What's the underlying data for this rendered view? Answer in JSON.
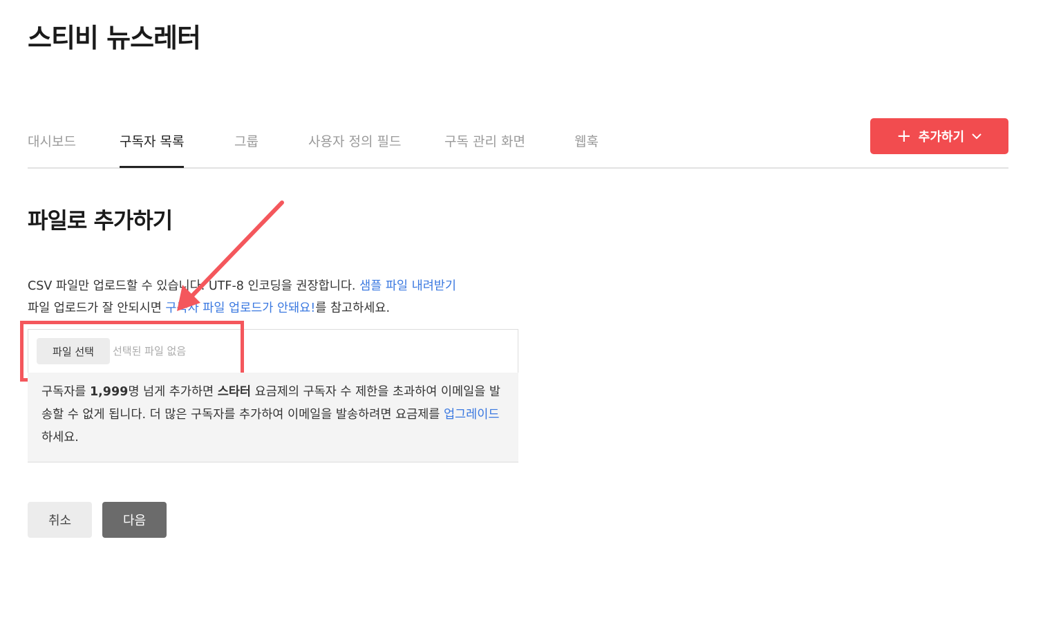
{
  "page": {
    "title": "스티비 뉴스레터"
  },
  "tabs": [
    {
      "label": "대시보드",
      "active": false
    },
    {
      "label": "구독자 목록",
      "active": true
    },
    {
      "label": "그룹",
      "active": false
    },
    {
      "label": "사용자 정의 필드",
      "active": false
    },
    {
      "label": "구독 관리 화면",
      "active": false
    },
    {
      "label": "웹훅",
      "active": false
    }
  ],
  "add_button": {
    "icon": "plus-icon",
    "label": "추가하기",
    "chevron": "chevron-down-icon"
  },
  "section": {
    "title": "파일로 추가하기"
  },
  "description": {
    "line1_text": "CSV 파일만 업로드할 수 있습니다. UTF-8 인코딩을 권장합니다.",
    "line1_link": "샘플 파일 내려받기",
    "line2_prefix": "파일 업로드가 잘 안되시면",
    "line2_link": "구독자 파일 업로드가 안돼요!",
    "line2_suffix": "를 참고하세요."
  },
  "file_input": {
    "button_label": "파일 선택",
    "status": "선택된 파일 없음"
  },
  "notice": {
    "part1": "구독자를 ",
    "count": "1,999",
    "part2": "명 넘게 추가하면 ",
    "plan": "스타터",
    "part3": " 요금제의 구독자 수 제한을 초과하여 이메일을 발송할 수 없게 됩니다. 더 많은 구독자를 추가하여 이메일을 발송하려면 요금제를 ",
    "link": "업그레이드",
    "part4": " 하세요."
  },
  "actions": {
    "cancel_label": "취소",
    "next_label": "다음"
  },
  "colors": {
    "accent": "#f24c4f",
    "link": "#3a78e0",
    "annotation": "#f4575c",
    "next_button": "#6b6b6b"
  }
}
